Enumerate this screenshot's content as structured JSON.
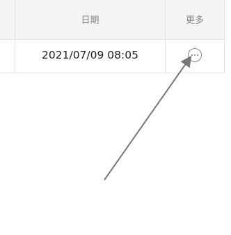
{
  "table": {
    "headers": {
      "date": "日期",
      "more": "更多"
    },
    "rows": [
      {
        "date": "2021/07/09 08:05"
      }
    ]
  },
  "icons": {
    "more_button": "ellipsis-circle-icon",
    "annotation": "pointer-arrow"
  },
  "colors": {
    "header_bg": "#f4f4f4",
    "border": "#e3e3e3",
    "header_text": "#888888",
    "cell_text": "#222222",
    "arrow": "#777777"
  }
}
